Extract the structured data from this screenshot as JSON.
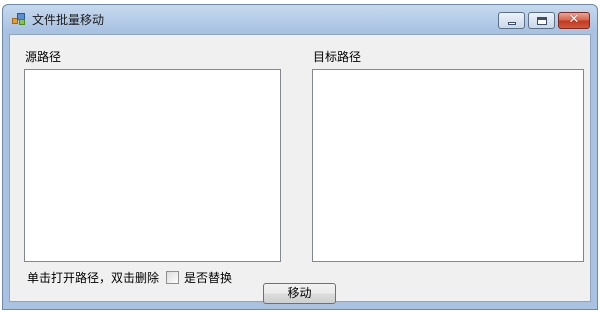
{
  "window": {
    "title": "文件批量移动",
    "controls": {
      "minimize_icon": "minimize-icon",
      "maximize_icon": "maximize-icon",
      "close_icon": "close-icon",
      "close_glyph": "✕"
    }
  },
  "source": {
    "label": "源路径",
    "items": []
  },
  "target": {
    "label": "目标路径",
    "items": []
  },
  "hint_text": "单击打开路径，双击删除",
  "replace_checkbox": {
    "label": "是否替换",
    "checked": false
  },
  "move_button": {
    "label": "移动"
  }
}
